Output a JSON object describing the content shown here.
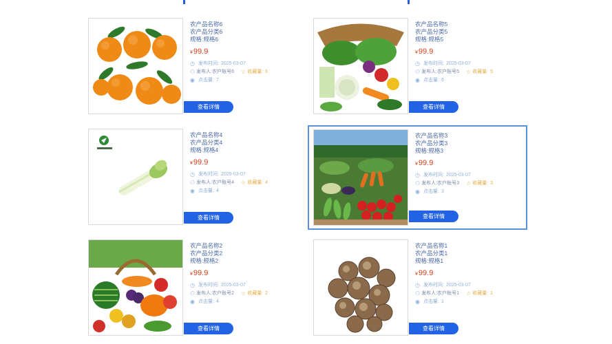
{
  "cards": [
    {
      "name": "农产品名称6",
      "category": "农产品分类6",
      "spec": "规格:规格6",
      "price": "99.9",
      "publish_time_label": "发布时间:",
      "publish_time": "2025-03-07",
      "publisher_label": "发布人:",
      "publisher": "农户账号6",
      "favorites_label": "收藏量:",
      "favorites": "6",
      "clicks_label": "点击量:",
      "clicks": "7",
      "image": "oranges",
      "button": "查看详情"
    },
    {
      "name": "农产品名称5",
      "category": "农产品分类5",
      "spec": "规格:规格5",
      "price": "99.9",
      "publish_time_label": "发布时间:",
      "publish_time": "2025-03-07",
      "publisher_label": "发布人:",
      "publisher": "农户账号5",
      "favorites_label": "收藏量:",
      "favorites": "5",
      "clicks_label": "点击量:",
      "clicks": "6",
      "image": "vegetable-basket",
      "button": "查看详情"
    },
    {
      "name": "农产品名称4",
      "category": "农产品分类4",
      "spec": "规格:规格4",
      "price": "99.9",
      "publish_time_label": "发布时间:",
      "publish_time": "2025-03-07",
      "publisher_label": "发布人:",
      "publisher": "农户账号4",
      "favorites_label": "收藏量:",
      "favorites": "4",
      "clicks_label": "点击量:",
      "clicks": "4",
      "image": "celery",
      "button": "查看详情"
    },
    {
      "name": "农产品名称3",
      "category": "农产品分类3",
      "spec": "规格:规格3",
      "price": "99.9",
      "publish_time_label": "发布时间:",
      "publish_time": "2025-03-07",
      "publisher_label": "发布人:",
      "publisher": "农户账号3",
      "favorites_label": "收藏量:",
      "favorites": "3",
      "clicks_label": "点击量:",
      "clicks": "3",
      "image": "vegetable-field",
      "button": "查看详情"
    },
    {
      "name": "农产品名称2",
      "category": "农产品分类2",
      "spec": "规格:规格2",
      "price": "99.9",
      "publish_time_label": "发布时间:",
      "publish_time": "2025-03-07",
      "publisher_label": "发布人:",
      "publisher": "农户账号2",
      "favorites_label": "收藏量:",
      "favorites": "2",
      "clicks_label": "点击量:",
      "clicks": "4",
      "image": "fruit-basket",
      "button": "查看详情"
    },
    {
      "name": "农产品名称1",
      "category": "农产品分类1",
      "spec": "规格:规格1",
      "price": "99.9",
      "publish_time_label": "发布时间:",
      "publish_time": "2025-03-07",
      "publisher_label": "发布人:",
      "publisher": "农户账号1",
      "favorites_label": "收藏量:",
      "favorites": "1",
      "clicks_label": "点击量:",
      "clicks": "1",
      "image": "mushrooms",
      "button": "查看详情"
    }
  ],
  "currency_symbol": "¥",
  "colors": {
    "accent": "#2263e6",
    "price": "#d0421b",
    "text": "#4a6aa8",
    "gold": "#e2b04a",
    "selected_border": "#5b8fe0"
  }
}
